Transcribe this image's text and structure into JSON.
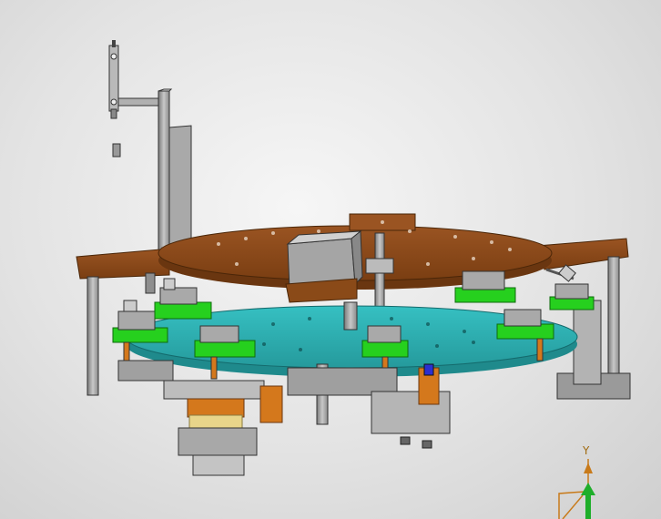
{
  "viewport": {
    "background_top": "#f6f6f6",
    "background_bottom": "#cfcfcf"
  },
  "colors": {
    "wood_plate": "#8a4a18",
    "wood_plate_edge": "#6a3610",
    "rotary_table": "#2fb2b4",
    "rotary_table_edge": "#1f8a8c",
    "fixture_green": "#26d01e",
    "fixture_green_dark": "#189214",
    "steel_grey": "#a8a8a8",
    "steel_dark": "#6e6e6e",
    "orange_part": "#d4781c",
    "yellow_band": "#e8d58a",
    "axis_y": "#1fae2a",
    "axis_frame": "#c87a1a"
  },
  "triad": {
    "y_axis_label": "Y"
  },
  "icons": [
    "view-orientation-triad-icon"
  ]
}
